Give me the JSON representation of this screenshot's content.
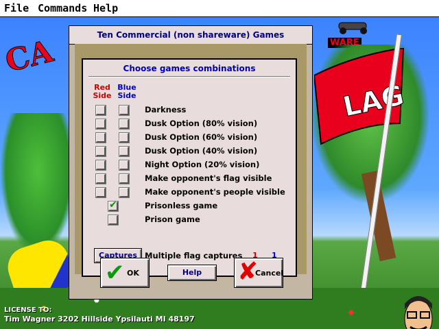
{
  "menu": {
    "items": [
      "File",
      "Commands",
      "Help"
    ]
  },
  "background": {
    "letters_left": "CA",
    "word_top_right": "WARE",
    "flag_text": "LAG",
    "license": {
      "line1": "LICENSE TO:",
      "line2": "Tim Wagner  3202 Hillside Ypsilauti MI 48197"
    }
  },
  "dialog": {
    "title": "Ten Commercial (non shareware) Games",
    "group_title": "Choose games combinations",
    "columns": {
      "red": "Red Side",
      "blue": "Blue Side"
    },
    "options": [
      {
        "label": "Darkness",
        "red_checked": false,
        "blue_checked": false
      },
      {
        "label": "Dusk Option (80% vision)",
        "red_checked": false,
        "blue_checked": false
      },
      {
        "label": "Dusk Option (60% vision)",
        "red_checked": false,
        "blue_checked": false
      },
      {
        "label": "Dusk Option (40% vision)",
        "red_checked": false,
        "blue_checked": false
      },
      {
        "label": "Night Option (20% vision)",
        "red_checked": false,
        "blue_checked": false
      },
      {
        "label": "Make opponent's flag visible",
        "red_checked": false,
        "blue_checked": false
      },
      {
        "label": "Make opponent's people visible",
        "red_checked": false,
        "blue_checked": false
      }
    ],
    "prison_options": [
      {
        "label": "Prisonless game",
        "checked": true
      },
      {
        "label": "Prison game",
        "checked": false
      }
    ],
    "captures": {
      "button": "Captures",
      "label": "Multiple flag captures",
      "red_count": "1",
      "blue_count": "1"
    },
    "buttons": {
      "ok": "OK",
      "help": "Help",
      "cancel": "Cancel"
    }
  },
  "colors": {
    "dialog_bg": "#c3b7a4",
    "group_bg": "#e9dcdc",
    "title_text": "#000080",
    "red": "#cc0000",
    "blue": "#0000cc",
    "check": "#0a8f0a"
  }
}
